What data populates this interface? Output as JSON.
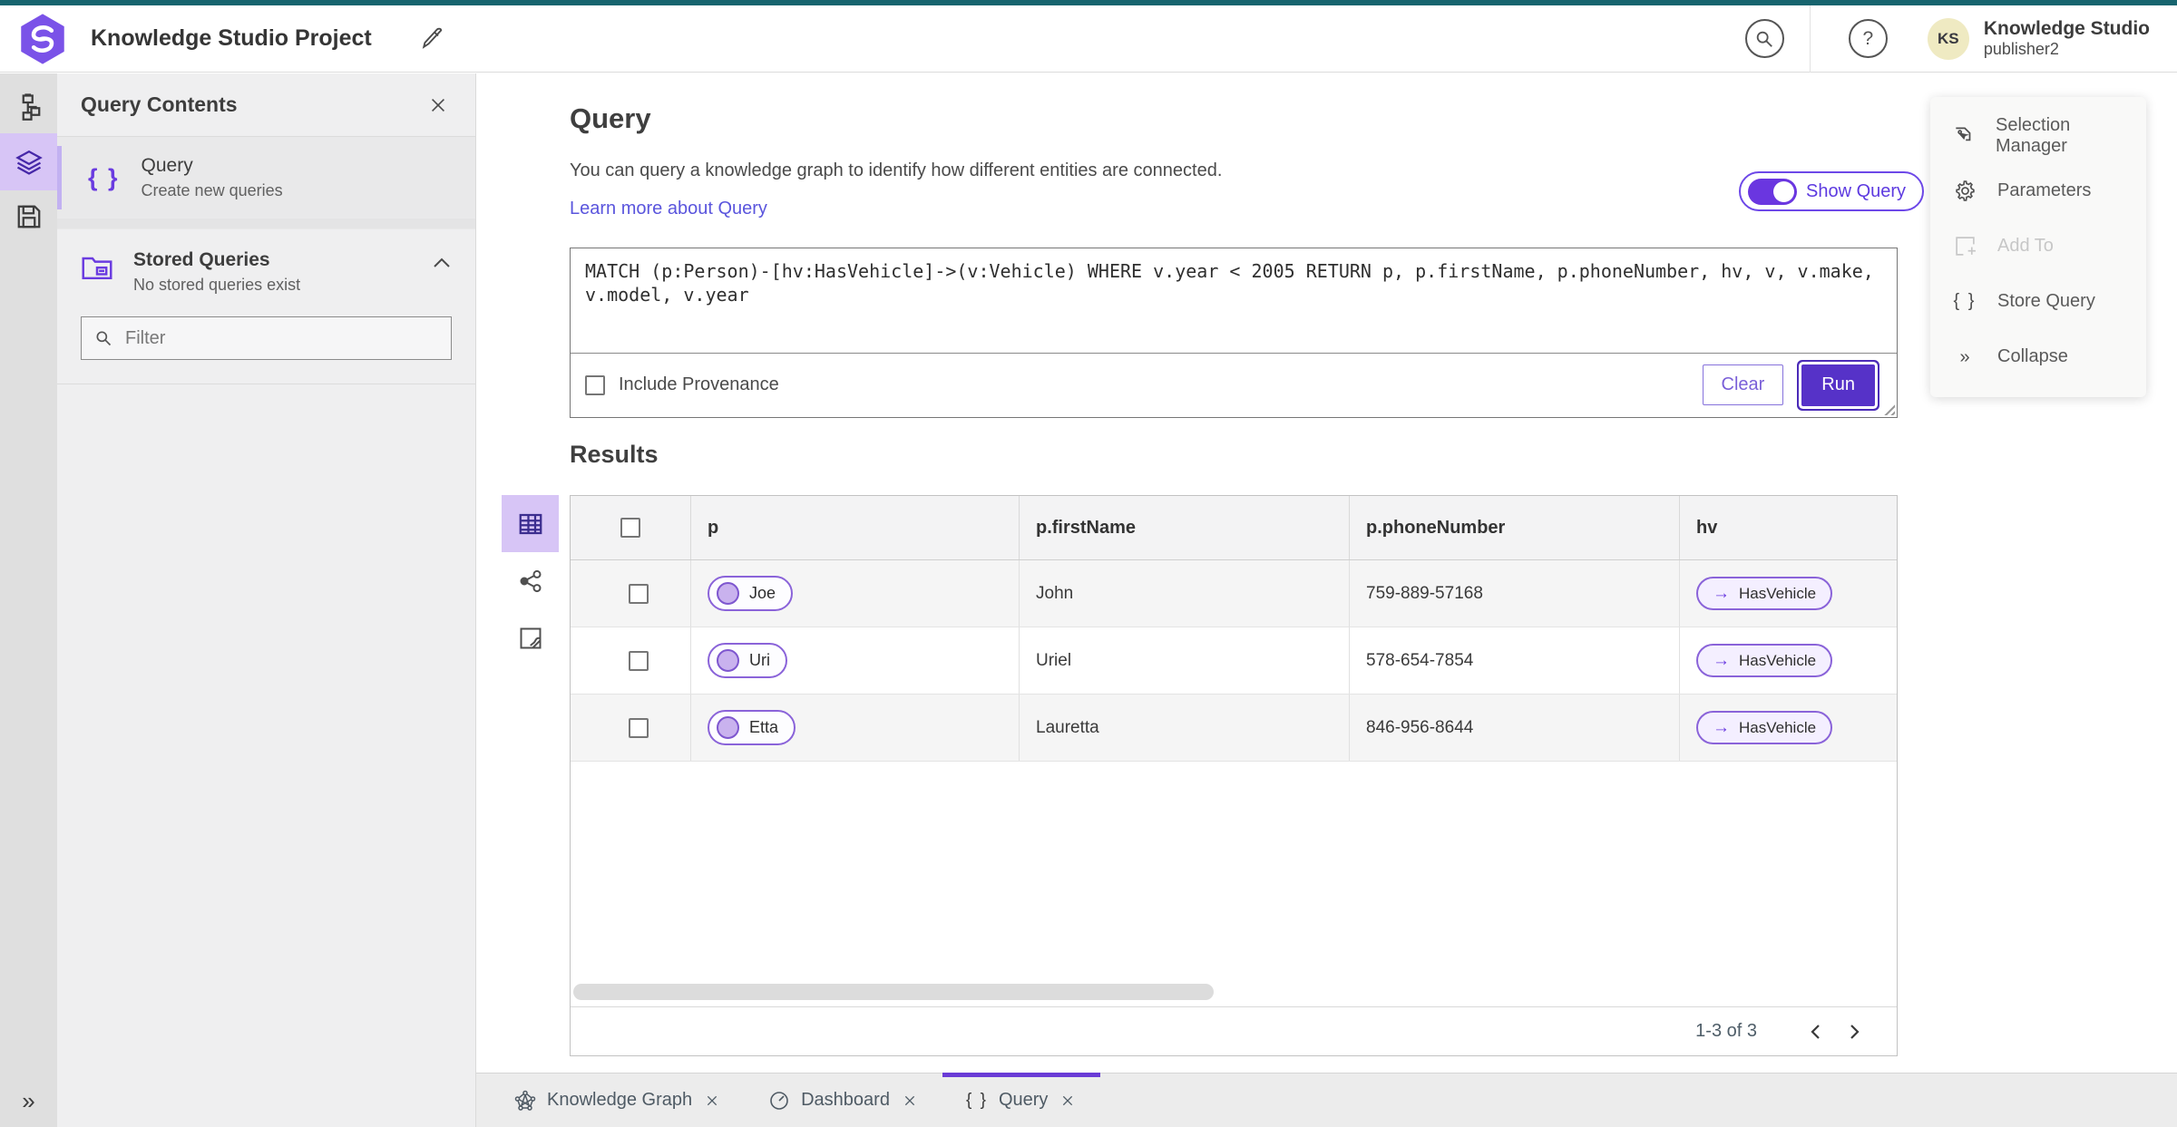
{
  "colors": {
    "accent_purple": "#6a3be0",
    "run_button": "#5632c8",
    "top_strip_teal": "#17646e",
    "active_icon_bg": "#d7c5f6",
    "link": "#5a55dd",
    "avatar_bg": "#efeac2",
    "pill_border": "#8a63d9",
    "pill_circle_fill": "#c9b2ee",
    "active_tab_bar": "#6a3bd6"
  },
  "icons": {
    "help_glyph": "?",
    "braces_glyph": "{ }",
    "collapse_glyph": "»",
    "expand_rail_glyph": "»",
    "arrow_right_glyph": "→"
  },
  "topbar": {
    "title": "Knowledge Studio Project",
    "user": {
      "initials": "KS",
      "name": "Knowledge Studio",
      "role": "publisher2"
    }
  },
  "contents_panel": {
    "title": "Query Contents",
    "query_item": {
      "title": "Query",
      "subtitle": "Create new queries"
    },
    "stored_queries": {
      "title": "Stored Queries",
      "subtitle": "No stored queries exist"
    },
    "filter_placeholder": "Filter"
  },
  "query_section": {
    "title": "Query",
    "description": "You can query a knowledge graph to identify how different entities are connected.",
    "learn_more": "Learn more about Query",
    "show_query": "Show Query",
    "query_text": "MATCH (p:Person)-[hv:HasVehicle]->(v:Vehicle) WHERE v.year < 2005 RETURN p, p.firstName, p.phoneNumber, hv, v, v.make, v.model, v.year",
    "include_provenance": "Include Provenance",
    "clear": "Clear",
    "run": "Run"
  },
  "results": {
    "title": "Results",
    "columns": [
      "p",
      "p.firstName",
      "p.phoneNumber",
      "hv"
    ],
    "rows": [
      {
        "p": "Joe",
        "firstName": "John",
        "phone": "759-889-57168",
        "hv": "HasVehicle"
      },
      {
        "p": "Uri",
        "firstName": "Uriel",
        "phone": "578-654-7854",
        "hv": "HasVehicle"
      },
      {
        "p": "Etta",
        "firstName": "Lauretta",
        "phone": "846-956-8644",
        "hv": "HasVehicle"
      }
    ],
    "pagination": "1-3 of 3"
  },
  "context_menu": {
    "items": [
      {
        "label": "Selection Manager",
        "disabled": false
      },
      {
        "label": "Parameters",
        "disabled": false
      },
      {
        "label": "Add To",
        "disabled": true
      },
      {
        "label": "Store Query",
        "disabled": false
      },
      {
        "label": "Collapse",
        "disabled": false
      }
    ]
  },
  "tabs": [
    {
      "label": "Knowledge Graph",
      "active": false
    },
    {
      "label": "Dashboard",
      "active": false
    },
    {
      "label": "Query",
      "active": true
    }
  ]
}
